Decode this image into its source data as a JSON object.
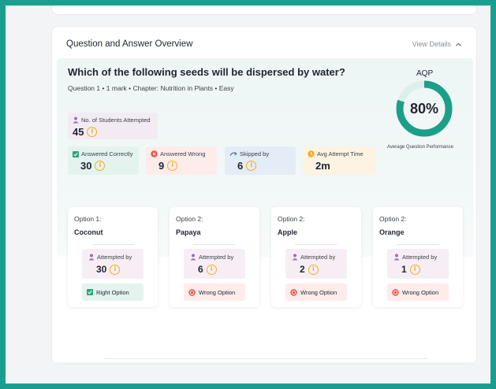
{
  "panel": {
    "title": "Question and Answer Overview",
    "view_details": "View Details"
  },
  "question": {
    "text": "Which of the following seeds will be dispersed by water?",
    "meta": "Question 1 • 1 mark • Chapter: Nutrition in Plants • Easy"
  },
  "stats": {
    "attempted": {
      "label": "No. of Students Attempted",
      "value": "45",
      "icon": "person-icon"
    },
    "correct": {
      "label": "Answered Correctly",
      "value": "30",
      "icon": "check-icon"
    },
    "wrong": {
      "label": "Answered Wrong",
      "value": "9",
      "icon": "x-circle-icon"
    },
    "skipped": {
      "label": "Skipped by",
      "value": "6",
      "icon": "skip-arrow-icon"
    },
    "avg_time": {
      "label": "Avg Attempt Time",
      "value": "2m",
      "icon": "clock-icon"
    }
  },
  "aqp": {
    "title": "AQP",
    "value": "80%",
    "fraction": 0.8,
    "caption": "Average Question Performance"
  },
  "options": [
    {
      "number": "Option 1:",
      "name": "Coconut",
      "attempted_label": "Attempted by",
      "attempted": "30",
      "status": "Right Option",
      "correct": true
    },
    {
      "number": "Option 2:",
      "name": "Papaya",
      "attempted_label": "Attempted by",
      "attempted": "6",
      "status": "Wrong Option",
      "correct": false
    },
    {
      "number": "Option 2:",
      "name": "Apple",
      "attempted_label": "Attempted by",
      "attempted": "2",
      "status": "Wrong Option",
      "correct": false
    },
    {
      "number": "Option 2:",
      "name": "Orange",
      "attempted_label": "Attempted by",
      "attempted": "1",
      "status": "Wrong Option",
      "correct": false
    }
  ],
  "info_glyph": "i",
  "colors": {
    "frame": "#1a9e8f",
    "ring": "#1aa087",
    "ring_track": "#ddeeed",
    "correct_bg": "#e4f3ee",
    "wrong_bg": "#fdecea",
    "skipped_bg": "#e3ecf7",
    "time_bg": "#fdf3e2",
    "attempted_bg": "#f3ebf4",
    "info": "#f2b01e"
  }
}
